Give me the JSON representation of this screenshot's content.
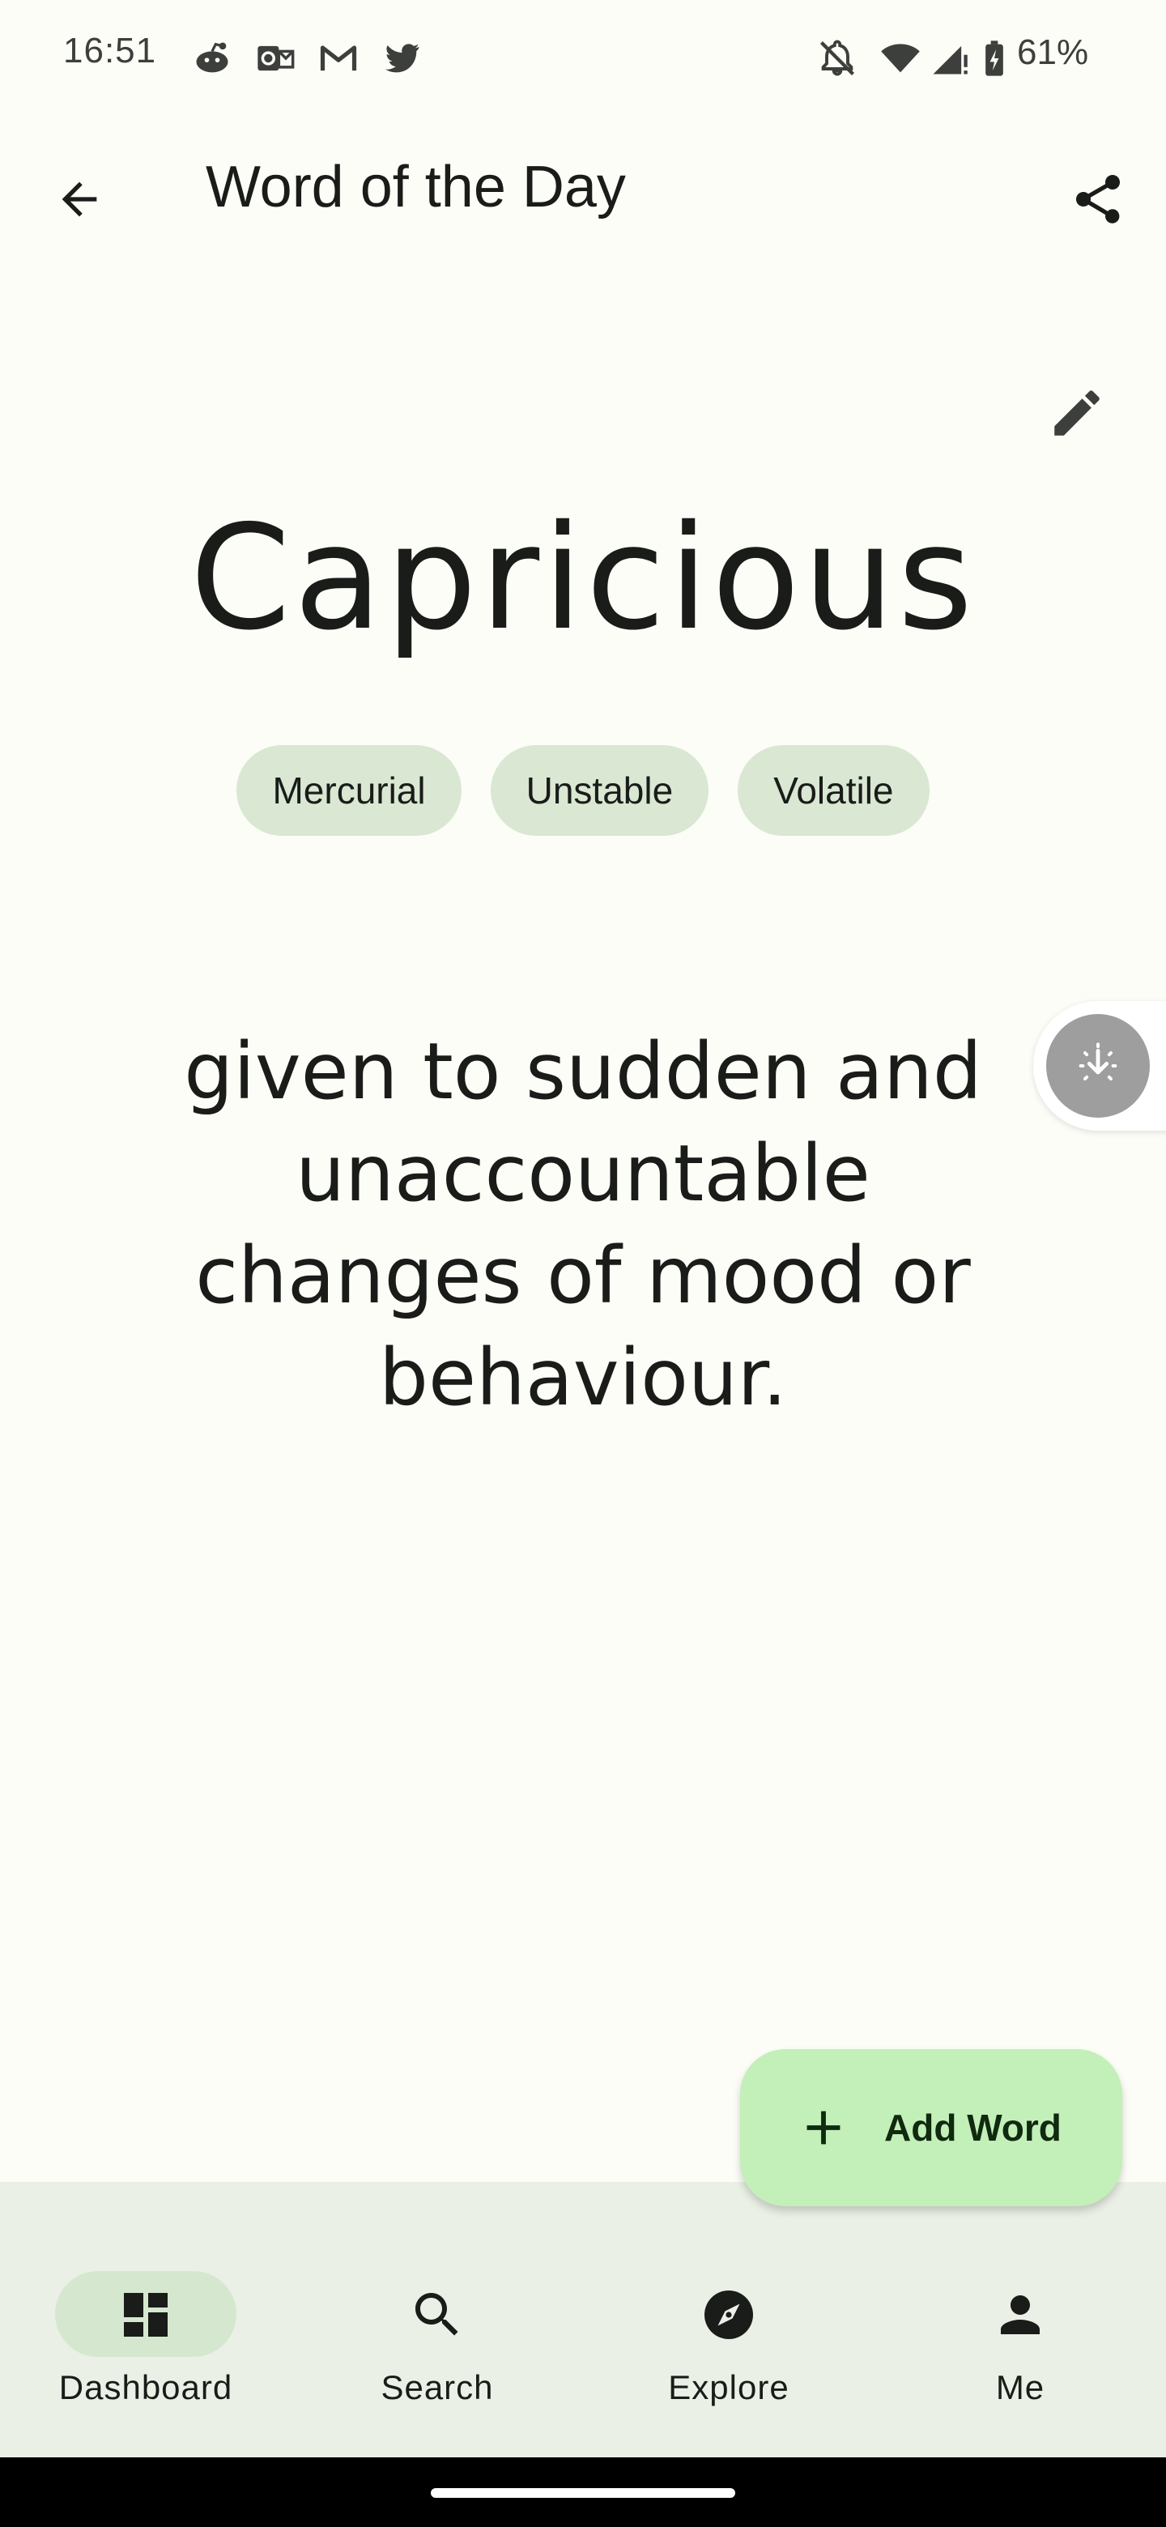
{
  "status_bar": {
    "time": "16:51",
    "battery": "61%",
    "icons": [
      "reddit-icon",
      "outlook-icon",
      "gmail-icon",
      "twitter-icon",
      "notifications-off-icon",
      "wifi-icon",
      "signal-icon",
      "battery-charging-icon"
    ]
  },
  "app_bar": {
    "title": "Word of the Day",
    "back_icon": "arrow-back-icon",
    "share_icon": "share-icon"
  },
  "word": {
    "edit_icon": "pencil-icon",
    "text": "Capricious",
    "synonyms": [
      "Mercurial",
      "Unstable",
      "Volatile"
    ],
    "definition": "given to sudden and unaccountable changes of mood or behaviour."
  },
  "fab": {
    "label": "Add Word",
    "icon": "plus-icon"
  },
  "bottom_nav": {
    "items": [
      {
        "label": "Dashboard",
        "icon": "dashboard-icon",
        "active": true
      },
      {
        "label": "Search",
        "icon": "search-icon",
        "active": false
      },
      {
        "label": "Explore",
        "icon": "compass-icon",
        "active": false
      },
      {
        "label": "Me",
        "icon": "person-icon",
        "active": false
      }
    ]
  },
  "colors": {
    "background": "#fcfdf7",
    "chip": "#d9e7d3",
    "fab": "#c3efb9",
    "nav_background": "#eaf0e6",
    "nav_active_pill": "#d5e8cf"
  }
}
